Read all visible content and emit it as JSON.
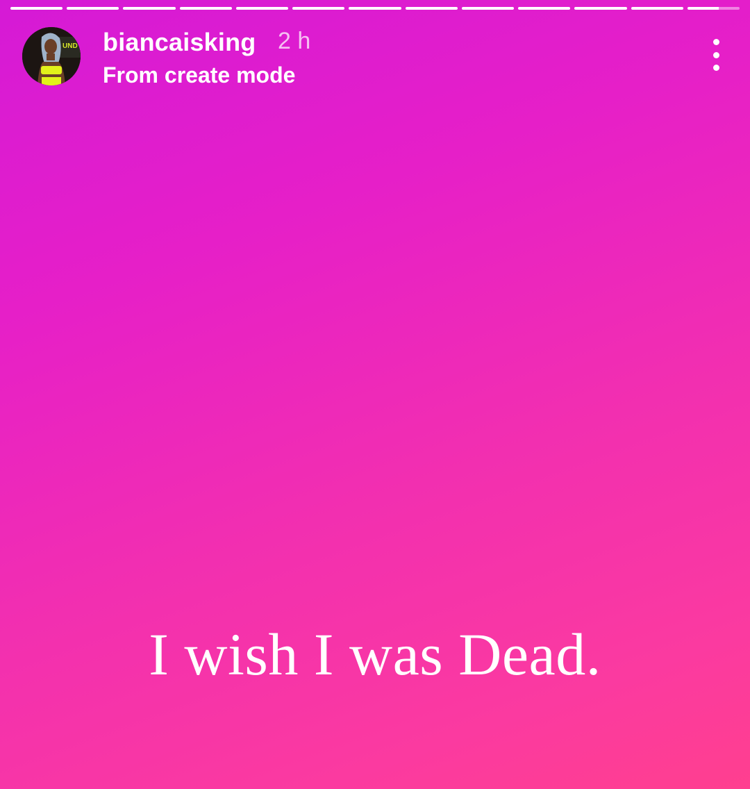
{
  "story": {
    "username": "biancaisking",
    "time": "2 h",
    "subtitle": "From create mode",
    "caption": "I wish I was Dead.",
    "segments_total": 13,
    "current_segment": 13,
    "current_segment_progress": 0.6,
    "avatar_text": "UND RVT"
  },
  "colors": {
    "gradient_start": "#d51ad6",
    "gradient_end": "#ff3f8f",
    "text": "#ffffff"
  },
  "icons": {
    "more": "more-vertical-icon"
  }
}
